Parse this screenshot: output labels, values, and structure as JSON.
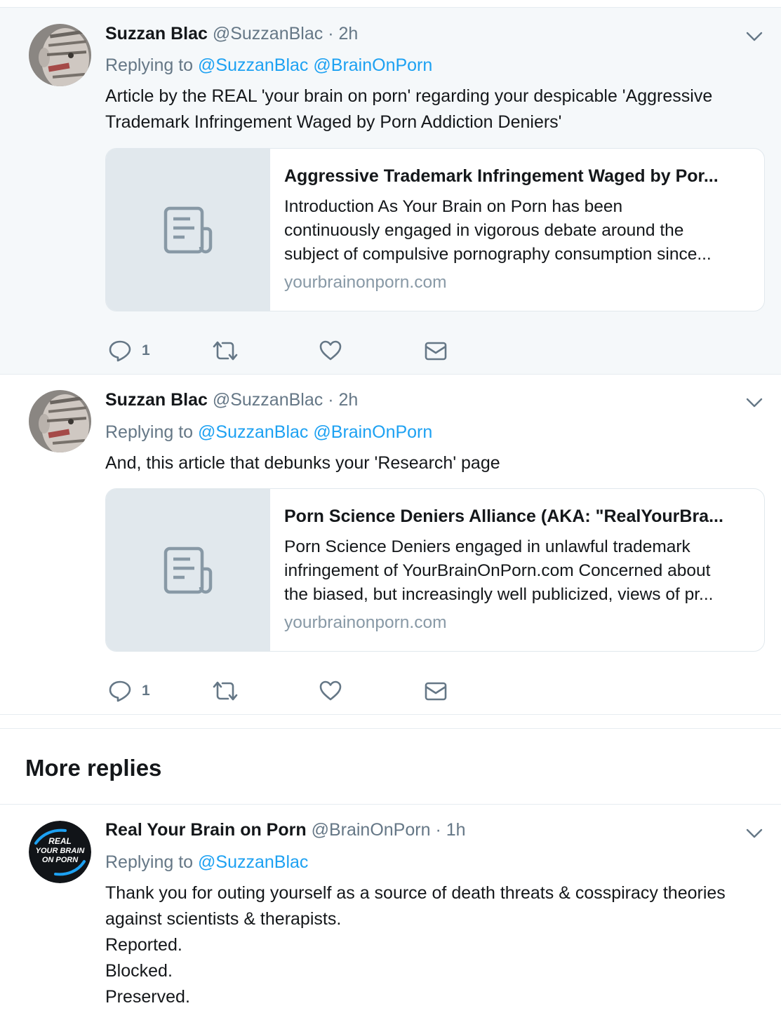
{
  "tweets": [
    {
      "name": "Suzzan Blac",
      "handle": "@SuzzanBlac",
      "dot": "·",
      "time": "2h",
      "replying_label": "Replying to",
      "mentions": [
        "@SuzzanBlac",
        "@BrainOnPorn"
      ],
      "text_lines": [
        "Article by the REAL 'your brain on porn' regarding your despicable 'Aggressive",
        "Trademark Infringement Waged by Porn Addiction Deniers'"
      ],
      "card": {
        "title": "Aggressive Trademark Infringement Waged by Por...",
        "desc_lines": [
          "Introduction As Your Brain on Porn has been",
          "continuously engaged in vigorous debate around the",
          "subject of compulsive pornography consumption since..."
        ],
        "domain": "yourbrainonporn.com"
      },
      "reply_count": "1"
    },
    {
      "name": "Suzzan Blac",
      "handle": "@SuzzanBlac",
      "dot": "·",
      "time": "2h",
      "replying_label": "Replying to",
      "mentions": [
        "@SuzzanBlac",
        "@BrainOnPorn"
      ],
      "text_lines": [
        "And, this article that debunks your 'Research' page"
      ],
      "card": {
        "title": "Porn Science Deniers Alliance (AKA: \"RealYourBra...",
        "desc_lines": [
          "Porn Science Deniers engaged in unlawful trademark",
          "infringement of YourBrainOnPorn.com Concerned about",
          "the biased, but increasingly well publicized, views of pr..."
        ],
        "domain": "yourbrainonporn.com"
      },
      "reply_count": "1"
    },
    {
      "name": "Real Your Brain on Porn",
      "handle": "@BrainOnPorn",
      "dot": "·",
      "time": "1h",
      "replying_label": "Replying to",
      "mentions": [
        "@SuzzanBlac"
      ],
      "text_lines": [
        "Thank you for outing yourself as a source of death threats & cosspiracy theories",
        "against scientists & therapists.",
        "Reported.",
        "Blocked.",
        "Preserved."
      ],
      "avatar_text": [
        "REAL",
        "YOUR BRAIN",
        "ON PORN"
      ]
    }
  ],
  "more_replies": "More replies",
  "colors": {
    "link": "#1da1f2",
    "muted": "#657786",
    "highlight_bg": "#f5f8fa",
    "border": "#e6ecf0"
  },
  "icons": {
    "reply": "reply-icon",
    "retweet": "retweet-icon",
    "like": "heart-icon",
    "dm": "envelope-icon",
    "caret": "chevron-down-icon",
    "card_placeholder": "document-icon"
  }
}
